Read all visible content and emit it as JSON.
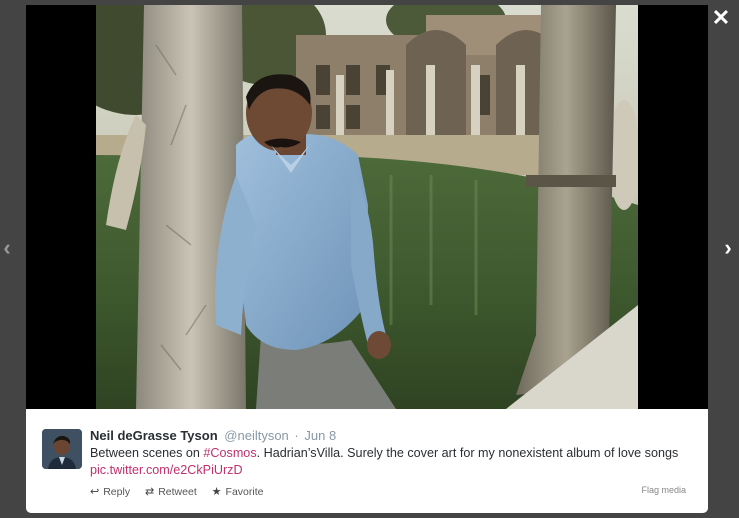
{
  "overlay": {
    "close_label": "✕",
    "prev_label": "‹",
    "next_label": "›"
  },
  "tweet": {
    "fullname": "Neil deGrasse Tyson",
    "username": "@neiltyson",
    "separator": "·",
    "time": "Jun 8",
    "text_parts": {
      "prefix": "Between scenes on ",
      "hashtag": "#Cosmos",
      "middle": ". Hadrian’sVilla. Surely the cover art for my nonexistent album of love songs ",
      "link": "pic.twitter.com/e2CkPiUrzD"
    },
    "actions": {
      "reply": "Reply",
      "retweet": "Retweet",
      "favorite": "Favorite"
    },
    "flag": "Flag media"
  },
  "icons": {
    "reply": "reply-icon",
    "retweet": "retweet-icon",
    "favorite": "star-icon",
    "close": "close-icon",
    "prev": "chevron-left-icon",
    "next": "chevron-right-icon"
  },
  "colors": {
    "link": "#c0306c",
    "name": "#292f33",
    "meta": "#8899a6"
  }
}
